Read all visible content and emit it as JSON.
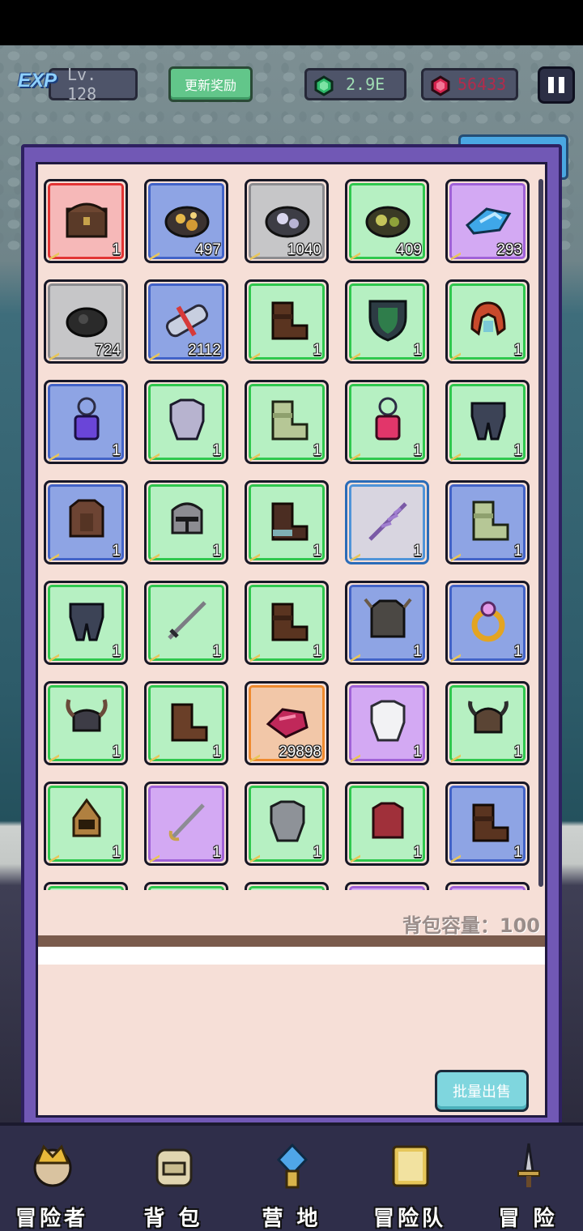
{
  "hud": {
    "exp_badge": "EXP",
    "level": "Lv. 128",
    "update_reward_button": "更新奖励",
    "gems": "2.9E",
    "rubies": "56433"
  },
  "inventory": {
    "items": [
      {
        "rarity": "red",
        "icon": "treasure-chest-icon",
        "count": "1"
      },
      {
        "rarity": "blue",
        "icon": "gold-ore-icon",
        "count": "497"
      },
      {
        "rarity": "gray",
        "icon": "silver-ore-icon",
        "count": "1040"
      },
      {
        "rarity": "green",
        "icon": "green-ore-icon",
        "count": "409"
      },
      {
        "rarity": "purple",
        "icon": "blue-crystal-icon",
        "count": "293"
      },
      {
        "rarity": "gray",
        "icon": "coal-ore-icon",
        "count": "724"
      },
      {
        "rarity": "blue",
        "icon": "scroll-icon",
        "count": "2112"
      },
      {
        "rarity": "green",
        "icon": "leather-boots-icon",
        "count": "1"
      },
      {
        "rarity": "green",
        "icon": "green-shield-icon",
        "count": "1"
      },
      {
        "rarity": "green",
        "icon": "crimson-gauntlet-icon",
        "count": "1"
      },
      {
        "rarity": "blue",
        "icon": "sapphire-amulet-icon",
        "count": "1"
      },
      {
        "rarity": "green",
        "icon": "silver-armor-icon",
        "count": "1"
      },
      {
        "rarity": "green",
        "icon": "cloth-boots-icon",
        "count": "1"
      },
      {
        "rarity": "green",
        "icon": "ruby-amulet-icon",
        "count": "1"
      },
      {
        "rarity": "green",
        "icon": "dark-leggings-icon",
        "count": "1"
      },
      {
        "rarity": "blue",
        "icon": "leather-armor-icon",
        "count": "1"
      },
      {
        "rarity": "green",
        "icon": "knight-helmet-icon",
        "count": "1"
      },
      {
        "rarity": "green",
        "icon": "dark-boots-icon",
        "count": "1"
      },
      {
        "rarity": "selected",
        "icon": "purple-branch-icon",
        "count": "1"
      },
      {
        "rarity": "blue",
        "icon": "cloth-boots-icon",
        "count": "1"
      },
      {
        "rarity": "green",
        "icon": "dark-leggings-icon",
        "count": "1"
      },
      {
        "rarity": "green",
        "icon": "longsword-icon",
        "count": "1"
      },
      {
        "rarity": "green",
        "icon": "leather-boots-icon",
        "count": "1"
      },
      {
        "rarity": "blue",
        "icon": "spiked-armor-icon",
        "count": "1"
      },
      {
        "rarity": "blue",
        "icon": "gold-ring-icon",
        "count": "1"
      },
      {
        "rarity": "green",
        "icon": "horned-helm-icon",
        "count": "1"
      },
      {
        "rarity": "green",
        "icon": "brown-boots-icon",
        "count": "1"
      },
      {
        "rarity": "orange",
        "icon": "ruby-gem-icon",
        "count": "29898"
      },
      {
        "rarity": "purple",
        "icon": "white-armor-icon",
        "count": "1"
      },
      {
        "rarity": "green",
        "icon": "viking-helmet-icon",
        "count": "1"
      },
      {
        "rarity": "green",
        "icon": "gold-helmet-icon",
        "count": "1"
      },
      {
        "rarity": "purple",
        "icon": "saber-icon",
        "count": "1"
      },
      {
        "rarity": "green",
        "icon": "steel-armor-icon",
        "count": "1"
      },
      {
        "rarity": "green",
        "icon": "red-armor-icon",
        "count": "1"
      },
      {
        "rarity": "blue",
        "icon": "leather-boots-icon",
        "count": "1"
      },
      {
        "rarity": "green",
        "icon": "",
        "count": ""
      },
      {
        "rarity": "green",
        "icon": "",
        "count": ""
      },
      {
        "rarity": "green",
        "icon": "",
        "count": ""
      },
      {
        "rarity": "purple",
        "icon": "",
        "count": ""
      },
      {
        "rarity": "purple",
        "icon": "",
        "count": ""
      }
    ],
    "capacity_label": "背包容量：100",
    "bulk_sell_button": "批量出售"
  },
  "nav": {
    "items": [
      {
        "label": "冒险者",
        "icon": "adventurer-icon"
      },
      {
        "label": "背 包",
        "icon": "backpack-icon"
      },
      {
        "label": "营 地",
        "icon": "camp-icon"
      },
      {
        "label": "冒险队",
        "icon": "party-book-icon"
      },
      {
        "label": "冒 险",
        "icon": "adventure-sword-icon"
      }
    ]
  }
}
